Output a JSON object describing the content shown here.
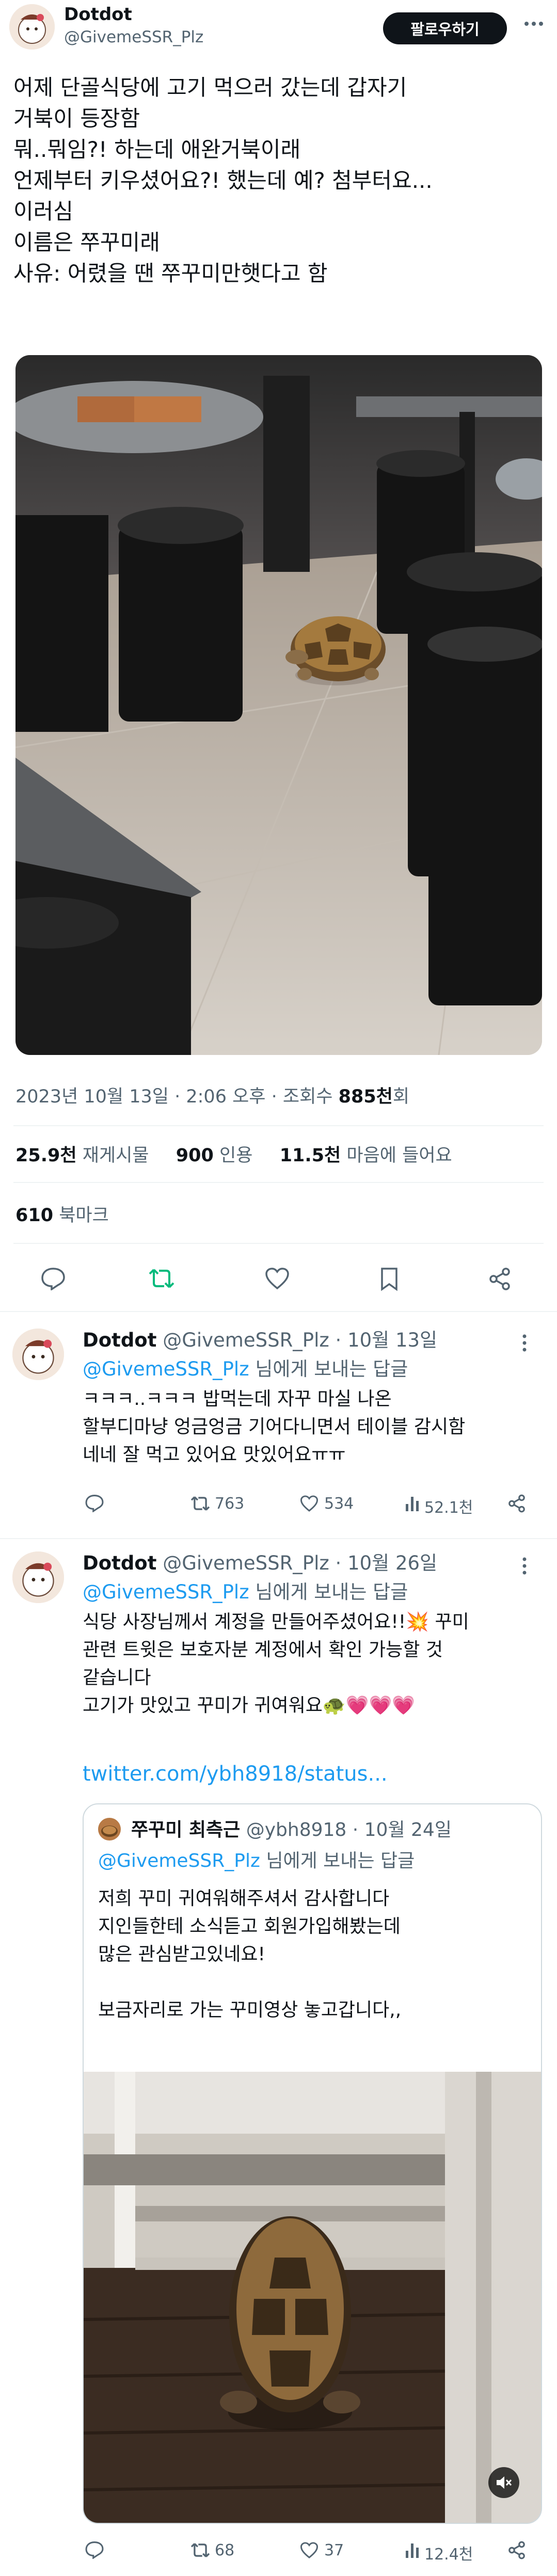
{
  "main_tweet": {
    "author_name": "Dotdot",
    "author_handle": "@GivemeSSR_Plz",
    "follow_label": "팔로우하기",
    "text_lines": [
      "어제 단골식당에 고기 먹으러 갔는데 갑자기",
      "거북이 등장함",
      "뭐..뭐임?! 하는데 애완거북이래",
      "언제부터 키우셨어요?! 했는데 예? 첨부터요...",
      "이러심",
      "이름은 쭈꾸미래",
      "사유: 어렸을 땐 쭈꾸미만햇다고 함"
    ],
    "timestamp": "2023년 10월 13일 · 2:06 오후 · 조회수",
    "views": "885천",
    "views_suffix": "회",
    "stats": {
      "retweets": "25.9천",
      "retweets_label": "재게시물",
      "quotes": "900",
      "quotes_label": "인용",
      "likes": "11.5천",
      "likes_label": "마음에 들어요",
      "bookmarks": "610",
      "bookmarks_label": "북마크"
    },
    "actions": [
      "reply-icon",
      "retweet-icon",
      "like-icon",
      "bookmark-icon",
      "share-icon"
    ]
  },
  "reply1": {
    "author_name": "Dotdot",
    "meta": "@GivemeSSR_Plz · 10월 13일",
    "reply_to_handle": "@GivemeSSR_Plz",
    "reply_to_suffix": " 님에게 보내는 답글",
    "text_lines": [
      "ㅋㅋㅋ..ㅋㅋㅋ 밥먹는데 자꾸 마실 나온",
      "할부디마냥 엉금엉금 기어다니면서 테이블 감시함",
      "네네 잘 먹고 있어요 맛있어요ㅠㅠ"
    ],
    "retweets": "763",
    "likes": "534",
    "views": "52.1천"
  },
  "reply2": {
    "author_name": "Dotdot",
    "meta": "@GivemeSSR_Plz · 10월 26일",
    "reply_to_handle": "@GivemeSSR_Plz",
    "reply_to_suffix": " 님에게 보내는 답글",
    "text_lines": [
      "식당 사장님께서 계정을 만들어주셨어요!!💥 꾸미",
      "관련 트윗은 보호자분 계정에서 확인 가능할 것",
      "같습니다",
      "고기가 맛있고 꾸미가 귀여워요🐢💗💗💗"
    ],
    "link": "twitter.com/ybh8918/status...",
    "retweets": "68",
    "likes": "37",
    "views": "12.4천"
  },
  "quote": {
    "author_name": "쭈꾸미 최측근",
    "meta": "@ybh8918 · 10월 24일",
    "reply_to_handle": "@GivemeSSR_Plz",
    "reply_to_suffix": " 님에게 보내는 답글",
    "text_lines": [
      "저희 꾸미 귀여워해주셔서 감사합니다",
      "지인들한테 소식듣고 회원가입해봤는데",
      "많은 관심받고있네요!",
      "",
      "보금자리로 가는 꾸미영상 놓고갑니다,,"
    ]
  },
  "colors": {
    "accent": "#1d9bf0",
    "text": "#0f1419",
    "muted": "#536471",
    "retweet_green": "#00ba7c"
  }
}
